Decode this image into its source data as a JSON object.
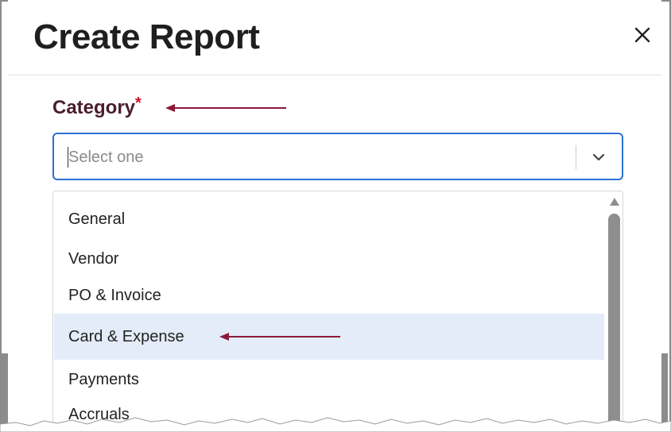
{
  "dialog": {
    "title": "Create Report",
    "close_icon": "close-icon"
  },
  "category": {
    "label": "Category",
    "required_marker": "*",
    "select": {
      "placeholder": "Select one",
      "chevron_icon": "chevron-down-icon"
    },
    "options": [
      {
        "label": "General",
        "selected": false
      },
      {
        "label": "Vendor",
        "selected": false
      },
      {
        "label": "PO & Invoice",
        "selected": false
      },
      {
        "label": "Card & Expense",
        "selected": true
      },
      {
        "label": "Payments",
        "selected": false
      },
      {
        "label": "Accruals",
        "selected": false
      }
    ]
  },
  "annotations": {
    "arrow_color": "#8b1a3a",
    "arrow_icon": "left-arrow-icon"
  },
  "colors": {
    "accent": "#2b6fd6",
    "label": "#4a1e2a",
    "required": "#c8102e",
    "selected_bg": "#e3ecf8"
  }
}
